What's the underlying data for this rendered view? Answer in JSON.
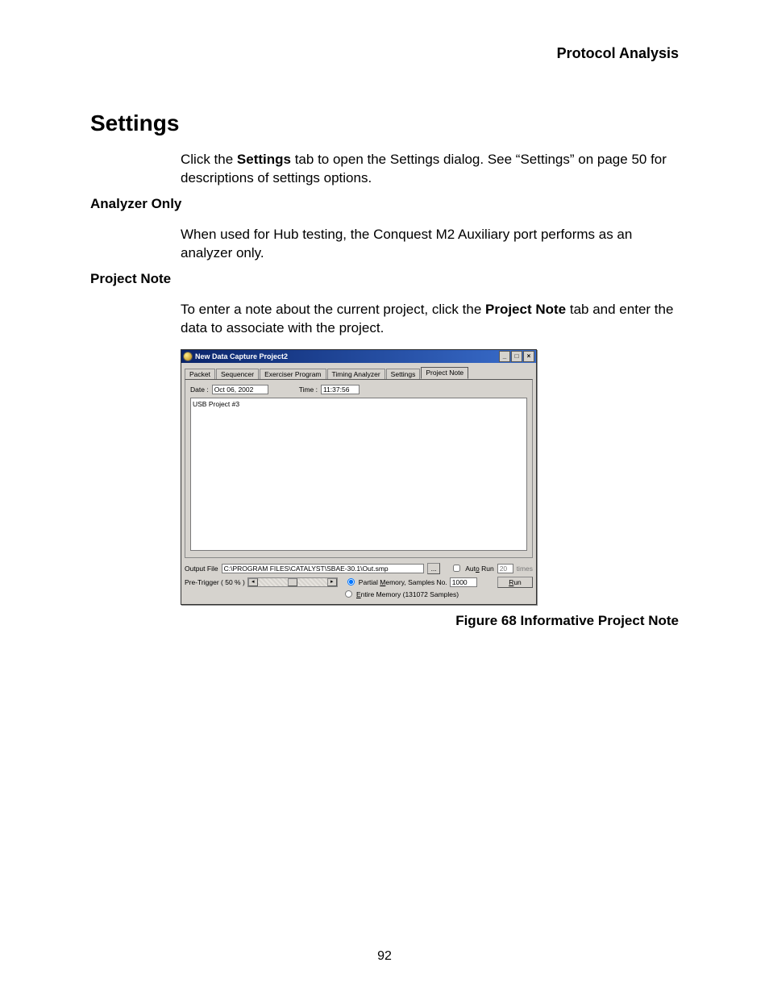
{
  "running_head": "Protocol Analysis",
  "section_title": "Settings",
  "para_settings_pre": "Click the ",
  "para_settings_bold": "Settings",
  "para_settings_post": " tab to open the Settings dialog. See “Settings” on page 50 for descriptions of settings options.",
  "sub_analyzer": "Analyzer Only",
  "para_analyzer": "When used for Hub testing, the Conquest M2 Auxiliary port performs as an analyzer only.",
  "sub_projectnote": "Project Note",
  "para_projectnote_pre": "To enter a note about the current project, click the ",
  "para_projectnote_bold": "Project Note",
  "para_projectnote_post": " tab and enter the data to associate with the project.",
  "figure_caption": "Figure  68  Informative Project Note",
  "page_number": "92",
  "win": {
    "title": "New Data Capture Project2",
    "tabs": [
      "Packet",
      "Sequencer",
      "Exerciser Program",
      "Timing Analyzer",
      "Settings",
      "Project Note"
    ],
    "date_label": "Date :",
    "date_value": "Oct 06, 2002",
    "time_label": "Time :",
    "time_value": "11:37:56",
    "note_text": "USB Project #3",
    "output_label": "Output File",
    "output_value": "C:\\PROGRAM FILES\\CATALYST\\SBAE-30.1\\Out.smp",
    "dots": "...",
    "autorun_pre": "Aut",
    "autorun_und": "o",
    "autorun_post": " Run",
    "autorun_value": "20",
    "autorun_suffix": "times",
    "pretrigger": "Pre-Trigger ( 50 % )",
    "partial_pre": "Partial ",
    "partial_und": "M",
    "partial_post": "emory, Samples No.",
    "partial_value": "1000",
    "entire_und": "E",
    "entire_post": "ntire Memory (131072 Samples)",
    "run_und": "R",
    "run_post": "un"
  }
}
